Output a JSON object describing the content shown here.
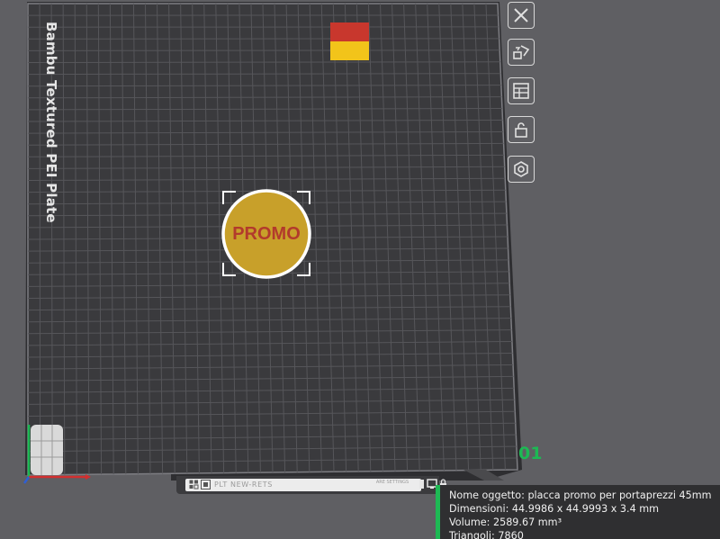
{
  "plate": {
    "label": "Bambu Textured PEI Plate",
    "number": "01",
    "colors": {
      "surface": "#3a3a3d",
      "grid": "#56565a",
      "edge": "#8a8a8e",
      "green": "#1db954"
    }
  },
  "object": {
    "text": "PROMO",
    "fill_color": "#c8a02a",
    "text_color": "#b23a2c",
    "outline_color": "#ffffff"
  },
  "filament_swatch": {
    "colors": [
      "#c8372d",
      "#f2c41a"
    ]
  },
  "toolbar": [
    {
      "name": "close-icon"
    },
    {
      "name": "swap-plate-icon"
    },
    {
      "name": "layout-icon"
    },
    {
      "name": "lock-icon"
    },
    {
      "name": "settings-icon"
    }
  ],
  "plate_toolbar": {
    "plate_name": "PLT NEW-RETS",
    "settings_text": "ARE SETTINGS"
  },
  "info": {
    "name_label": "Nome oggetto:",
    "name_value": "placca promo per portaprezzi 45mm",
    "dim_label": "Dimensioni:",
    "dim_value": "44.9986 x 44.9993 x 3.4 mm",
    "vol_label": "Volume:",
    "vol_value": "2589.67 mm³",
    "tri_label": "Triangoli:",
    "tri_value": "7860"
  }
}
